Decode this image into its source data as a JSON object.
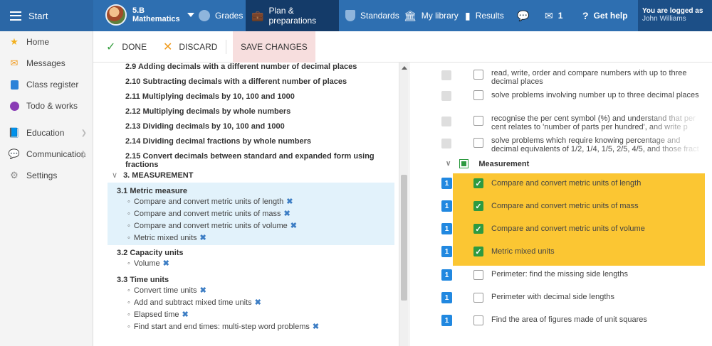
{
  "topbar": {
    "start_label": "Start",
    "class_code": "5.B",
    "class_subject": "Mathematics",
    "nav": {
      "grades": "Grades",
      "plan": "Plan & preparations",
      "standards": "Standards",
      "library": "My library",
      "results": "Results",
      "mail_count": "1",
      "help": "Get help"
    },
    "logged_as": "You are logged as",
    "user_name": "John Williams"
  },
  "sidebar": {
    "items": [
      {
        "label": "Home",
        "icon": "star-icon"
      },
      {
        "label": "Messages",
        "icon": "envelope-icon"
      },
      {
        "label": "Class register",
        "icon": "register-icon"
      },
      {
        "label": "Todo & works",
        "icon": "clock-icon"
      },
      {
        "label": "Education",
        "icon": "book-icon"
      },
      {
        "label": "Communication",
        "icon": "chat-icon"
      },
      {
        "label": "Settings",
        "icon": "gear-icon"
      }
    ]
  },
  "toolbar": {
    "done": "DONE",
    "discard": "DISCARD",
    "save": "SAVE CHANGES"
  },
  "tree": {
    "topics": [
      "2.9 Adding decimals with a different number of decimal places",
      "2.10 Subtracting decimals with a different number of places",
      "2.11 Multiplying decimals by 10, 100 and 1000",
      "2.12 Multiplying decimals by whole numbers",
      "2.13 Dividing decimals by 10, 100 and 1000",
      "2.14 Dividing decimal fractions by whole numbers",
      "2.15 Convert decimals between standard and expanded form using fractions"
    ],
    "section_title": "3. MEASUREMENT",
    "groups": [
      {
        "title": "3.1 Metric measure",
        "items": [
          "Compare and convert metric units of length",
          "Compare and convert metric units of mass",
          "Compare and convert metric units of volume",
          "Metric mixed units"
        ]
      },
      {
        "title": "3.2 Capacity units",
        "items": [
          "Volume"
        ]
      },
      {
        "title": "3.3 Time units",
        "items": [
          "Convert time units",
          "Add and subtract mixed time units",
          "Elapsed time",
          "Find start and end times: multi-step word problems"
        ]
      }
    ]
  },
  "standards": {
    "decimals": [
      "read, write, order and compare numbers with up to three decimal places",
      "solve problems involving number up to three decimal places",
      "recognise the per cent symbol (%) and understand that per cent relates to 'number of parts per hundred', and write p",
      "solve problems which require knowing percentage and decimal equivalents of 1/2, 1/4, 1/5, 2/5, 4/5, and those fract"
    ],
    "measurement_label": "Measurement",
    "measurement_items": [
      {
        "badge": "1",
        "text": "Compare and convert metric units of length",
        "checked": true
      },
      {
        "badge": "1",
        "text": "Compare and convert metric units of mass",
        "checked": true
      },
      {
        "badge": "1",
        "text": "Compare and convert metric units of volume",
        "checked": true
      },
      {
        "badge": "1",
        "text": "Metric mixed units",
        "checked": true
      },
      {
        "badge": "1",
        "text": "Perimeter: find the missing side lengths",
        "checked": false
      },
      {
        "badge": "1",
        "text": "Perimeter with decimal side lengths",
        "checked": false
      },
      {
        "badge": "1",
        "text": "Find the area of figures made of unit squares",
        "checked": false
      }
    ]
  },
  "colors": {
    "topbar": "#2e6fb1",
    "active_nav": "#143b69",
    "highlight_blue": "#e2f2fb",
    "highlight_yellow": "#fbc633",
    "badge_blue": "#2188e0",
    "check_green": "#2e9a41",
    "save_bg": "#f7dede"
  }
}
